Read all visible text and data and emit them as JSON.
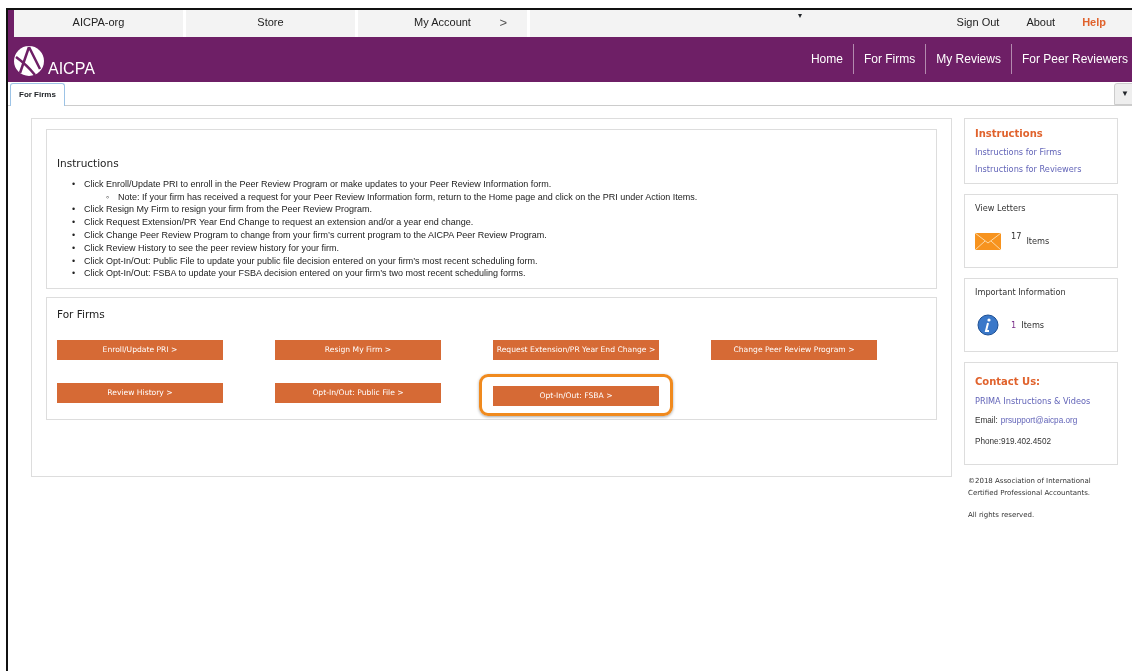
{
  "top_bar": {
    "links": [
      {
        "label": "AICPA-org"
      },
      {
        "label": "Store"
      },
      {
        "label": "My Account"
      }
    ],
    "account_arrow": ">",
    "menu_caret": "▾",
    "right_links": [
      {
        "label": "Sign Out",
        "highlighted": false
      },
      {
        "label": "About",
        "highlighted": false
      },
      {
        "label": "Help",
        "highlighted": true
      }
    ]
  },
  "header": {
    "logo_text": "AICPA",
    "nav": [
      {
        "label": "Home"
      },
      {
        "label": "For Firms"
      },
      {
        "label": "My Reviews"
      },
      {
        "label": "For Peer Reviewers"
      }
    ]
  },
  "tabs": [
    {
      "label": "For Firms",
      "selected": true
    }
  ],
  "tab_menu": "▼",
  "instructions": {
    "title": "Instructions",
    "items": [
      {
        "bullet": "•",
        "text": "Click Enroll/Update PRI to enroll in the Peer Review Program or make updates to your Peer Review Information form.",
        "children": [
          {
            "bullet": "◦",
            "text": "Note: If your firm has received a request for your Peer Review Information form, return to the Home page and click on the PRI under Action Items."
          }
        ]
      },
      {
        "bullet": "•",
        "text": "Click Resign My Firm to resign your firm from the Peer Review Program."
      },
      {
        "bullet": "•",
        "text": "Click Request Extension/PR Year End Change to request an extension and/or a year end change."
      },
      {
        "bullet": "•",
        "text": "Click Change Peer Review Program to change from your firm’s current program to the AICPA Peer Review Program."
      },
      {
        "bullet": "•",
        "text": "Click Review History to see the peer review history for your firm."
      },
      {
        "bullet": "•",
        "text": "Click Opt-In/Out: Public File to update your public file decision entered on your firm’s most recent scheduling form."
      },
      {
        "bullet": "•",
        "text": "Click Opt-In/Out: FSBA to update your FSBA decision entered on your firm’s two most recent scheduling forms."
      }
    ]
  },
  "for_firms": {
    "title": "For Firms",
    "buttons": [
      {
        "label": "Enroll/Update PRI >",
        "highlighted": false
      },
      {
        "label": "Resign My Firm >",
        "highlighted": false
      },
      {
        "label": "Request Extension/PR Year End Change >",
        "highlighted": false
      },
      {
        "label": "Change Peer Review Program >",
        "highlighted": false
      },
      {
        "label": "Review History >",
        "highlighted": false
      },
      {
        "label": "Opt-In/Out: Public File >",
        "highlighted": false
      },
      {
        "label": "Opt-In/Out: FSBA >",
        "highlighted": true
      }
    ]
  },
  "sidebar": {
    "panels": [
      {
        "kind": "links",
        "title": "Instructions",
        "links": [
          {
            "label": "Instructions for Firms"
          },
          {
            "label": "Instructions for Reviewers"
          }
        ]
      },
      {
        "kind": "letters",
        "title": "View Letters",
        "count": "17",
        "unit": "Items"
      },
      {
        "kind": "notices",
        "title": "Important Information",
        "count": "1",
        "unit": "Items"
      },
      {
        "kind": "contact",
        "title": "Contact Us:",
        "link": "PRIMA Instructions & Videos",
        "email_label": "Email:",
        "email": "prsupport@aicpa.org",
        "phone": "Phone:919.402.4502"
      }
    ],
    "copyright": "©2018 Association of International Certified Professional Accountants.",
    "rights": "All rights reserved."
  }
}
